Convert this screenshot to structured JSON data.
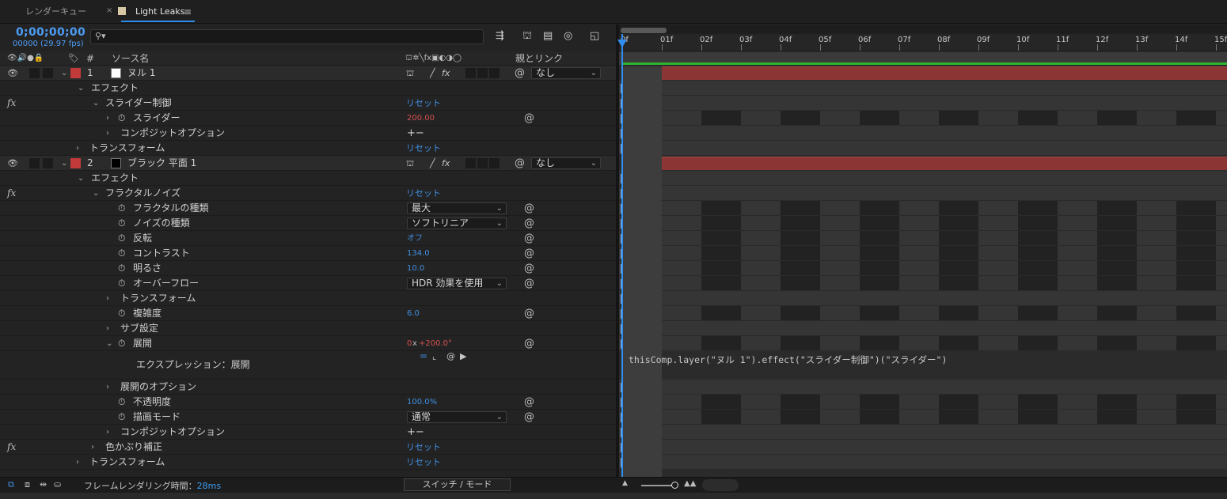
{
  "tabs": [
    {
      "label": "レンダーキュー"
    },
    {
      "label": "Light Leaks"
    }
  ],
  "timecode": "0;00;00;00",
  "frames": "00000 (29.97 fps)",
  "columns": {
    "source": "ソース名",
    "parent": "親とリンク",
    "num": "#"
  },
  "rows": [
    {
      "type": "layer",
      "num": "1",
      "name": "ヌル 1",
      "color": "#ffffff",
      "parent": "なし"
    },
    {
      "type": "group",
      "label": "エフェクト"
    },
    {
      "type": "effect",
      "label": "スライダー制御",
      "reset": "リセット"
    },
    {
      "type": "prop",
      "label": "スライダー",
      "value": "200.00",
      "value_color": "#d65050",
      "spiral": true,
      "arrow": true
    },
    {
      "type": "prop",
      "label": "コンポジットオプション",
      "plusminus": "+−",
      "arrow": true,
      "nostop": true
    },
    {
      "type": "group2",
      "label": "トランスフォーム",
      "reset": "リセット"
    },
    {
      "type": "layer",
      "num": "2",
      "name": "ブラック 平面 1",
      "color": "#000000",
      "parent": "なし"
    },
    {
      "type": "group",
      "label": "エフェクト"
    },
    {
      "type": "effect",
      "label": "フラクタルノイズ",
      "reset": "リセット"
    },
    {
      "type": "prop",
      "label": "フラクタルの種類",
      "dropdown": "最大",
      "spiral": true
    },
    {
      "type": "prop",
      "label": "ノイズの種類",
      "dropdown": "ソフトリニア",
      "spiral": true
    },
    {
      "type": "prop",
      "label": "反転",
      "value": "オフ",
      "spiral": true
    },
    {
      "type": "prop",
      "label": "コントラスト",
      "value": "134.0",
      "spiral": true
    },
    {
      "type": "prop",
      "label": "明るさ",
      "value": "10.0",
      "spiral": true
    },
    {
      "type": "prop",
      "label": "オーバーフロー",
      "dropdown": "HDR 効果を使用",
      "spiral": true
    },
    {
      "type": "prop",
      "label": "トランスフォーム",
      "arrow": true,
      "nostop": true
    },
    {
      "type": "prop",
      "label": "複雑度",
      "value": "6.0",
      "spiral": true
    },
    {
      "type": "prop",
      "label": "サブ設定",
      "arrow": true,
      "nostop": true
    },
    {
      "type": "prop",
      "label": "展開",
      "value_red": "0",
      "value_x": "x",
      "value_deg": "+200.0°",
      "spiral": true,
      "expanded": true
    },
    {
      "type": "expr",
      "label": "エクスプレッション：展開"
    },
    {
      "type": "prop",
      "label": "展開のオプション",
      "arrow": true,
      "nostop": true
    },
    {
      "type": "prop",
      "label": "不透明度",
      "value": "100.0%",
      "spiral": true
    },
    {
      "type": "prop",
      "label": "描画モード",
      "dropdown": "通常",
      "spiral": true
    },
    {
      "type": "prop",
      "label": "コンポジットオプション",
      "plusminus": "+−",
      "arrow": true,
      "nostop": true
    },
    {
      "type": "effect",
      "label": "色かぶり補正",
      "reset": "リセット",
      "collapsed": true
    },
    {
      "type": "group2",
      "label": "トランスフォーム",
      "reset": "リセット"
    }
  ],
  "ruler": [
    "0f",
    "01f",
    "02f",
    "03f",
    "04f",
    "05f",
    "06f",
    "07f",
    "08f",
    "09f",
    "10f",
    "11f",
    "12f",
    "13f",
    "14f",
    "15f"
  ],
  "expression": "thisComp.layer(\"ヌル 1\").effect(\"スライダー制御\")(\"スライダー\")",
  "bottom": {
    "render_label": "フレームレンダリング時間：",
    "render_value": "28ms",
    "switch_label": "スイッチ / モード"
  },
  "colors": {
    "accent": "#2d8ceb",
    "layer_bar": "#8c3535",
    "label_red": "#c23a3a",
    "value_blue": "#3f8fe0",
    "value_red": "#d65050",
    "workarea": "#2fb52f"
  }
}
